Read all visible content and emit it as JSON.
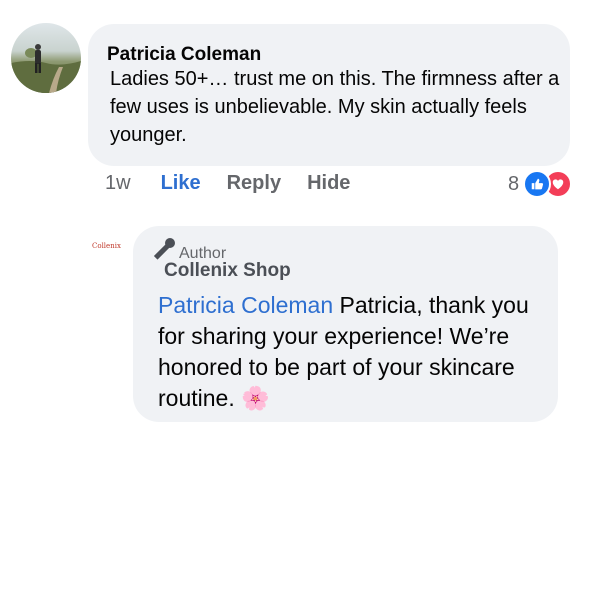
{
  "comment": {
    "author": "Patricia Coleman",
    "text": "Ladies 50+… trust me on this. The firmness after a few uses is unbelievable. My skin actually feels younger.",
    "time": "1w",
    "actions": {
      "like": "Like",
      "reply": "Reply",
      "hide": "Hide"
    },
    "reactions": {
      "count": "8",
      "icons": [
        "thumbs-up-icon",
        "heart-icon"
      ]
    }
  },
  "reply": {
    "brand_logo_text": "Collenix",
    "badge": {
      "icon": "microphone-icon",
      "label": "Author"
    },
    "author": "Collenix Shop",
    "mention": "Patricia Coleman",
    "text": " Patricia, thank you for sharing your experience! We’re honored to be part of your skincare routine. ",
    "emoji": "🌸"
  },
  "colors": {
    "bubble": "#f0f2f5",
    "accent_blue": "#2e6fd0",
    "like_blue": "#1877f2",
    "love_red": "#f33e58",
    "muted": "#65676b"
  }
}
